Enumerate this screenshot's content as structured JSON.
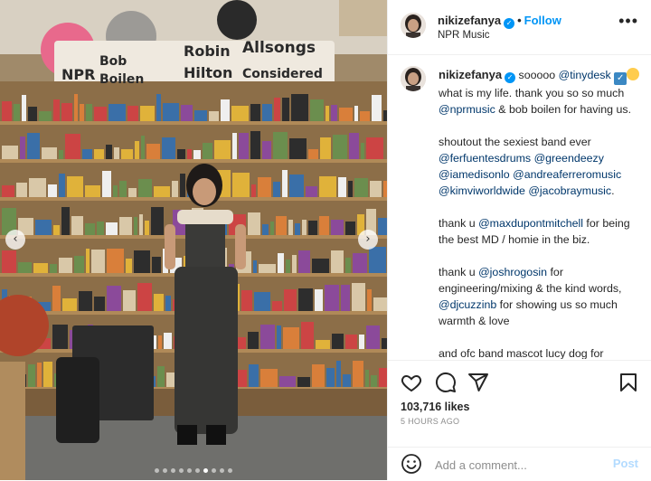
{
  "header": {
    "username": "nikizefanya",
    "follow_label": "Follow",
    "location": "NPR Music",
    "more": "•••"
  },
  "media": {
    "sign_text": [
      "NPR",
      "Bob",
      "Boilen",
      "Robin",
      "Hilton",
      "Allsongs",
      "Considered"
    ]
  },
  "caption": {
    "username": "nikizefanya",
    "p1_a": "sooooo ",
    "p1_mention": "@tinydesk",
    "p1_b": " what is my life. thank you so so much ",
    "p1_mention2": "@nprmusic",
    "p1_c": " & bob boilen for having us.",
    "p2_a": "shoutout the sexiest band ever",
    "p2_m1": "@ferfuentesdrums",
    "p2_m2": "@greendeezy",
    "p2_m3": "@iamedisonlo",
    "p2_m4": "@andreaferreromusic",
    "p2_m5": "@kimviworldwide",
    "p2_m6": "@jacobraymusic",
    "p3_a": "thank u ",
    "p3_m": "@maxdupontmitchell",
    "p3_b": " for being the best MD / homie in the biz.",
    "p4_a": "thank u ",
    "p4_m": "@joshrogosin",
    "p4_b": " for engineering/mixing & the kind words, ",
    "p4_m2": "@djcuzzinb",
    "p4_c": " for showing us so much warmth & love",
    "p5": "and ofc band mascot lucy dog for supportively nipping at my pant leg in"
  },
  "actions": {
    "likes": "103,716 likes",
    "time_ago": "5 HOURS AGO"
  },
  "comment": {
    "placeholder": "Add a comment...",
    "post_label": "Post"
  },
  "icons": {
    "like": "heart-icon",
    "comment": "comment-icon",
    "share": "send-icon",
    "save": "bookmark-icon",
    "emoji": "smiley-icon"
  },
  "colors": {
    "accent": "#0095f6",
    "mention": "#00376b",
    "muted": "#8e8e8e"
  }
}
